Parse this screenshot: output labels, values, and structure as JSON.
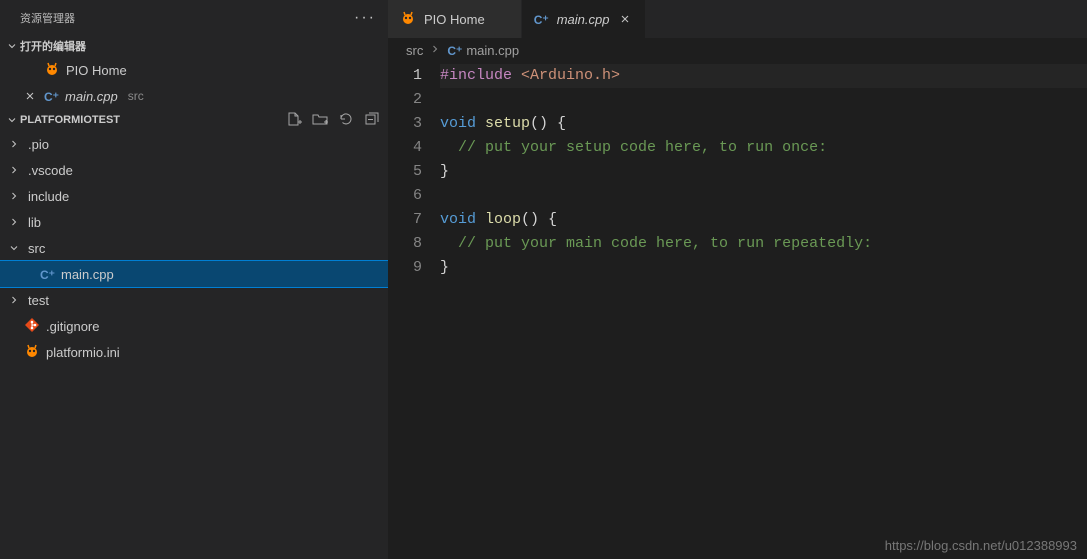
{
  "sidebar": {
    "title": "资源管理器",
    "openEditorsHeader": "打开的编辑器",
    "openEditors": [
      {
        "label": "PIO Home",
        "icon": "pio",
        "closable": false
      },
      {
        "label": "main.cpp",
        "dir": "src",
        "icon": "cpp",
        "closable": true,
        "italic": true
      }
    ],
    "projectName": "PLATFORMIOTEST",
    "tree": [
      {
        "label": ".pio",
        "type": "folder",
        "expanded": false,
        "depth": 0
      },
      {
        "label": ".vscode",
        "type": "folder",
        "expanded": false,
        "depth": 0
      },
      {
        "label": "include",
        "type": "folder",
        "expanded": false,
        "depth": 0
      },
      {
        "label": "lib",
        "type": "folder",
        "expanded": false,
        "depth": 0
      },
      {
        "label": "src",
        "type": "folder",
        "expanded": true,
        "depth": 0
      },
      {
        "label": "main.cpp",
        "type": "file",
        "icon": "cpp",
        "depth": 1,
        "selected": true
      },
      {
        "label": "test",
        "type": "folder",
        "expanded": false,
        "depth": 0
      },
      {
        "label": ".gitignore",
        "type": "file",
        "icon": "git",
        "depth": 0
      },
      {
        "label": "platformio.ini",
        "type": "file",
        "icon": "pio",
        "depth": 0
      }
    ]
  },
  "tabs": [
    {
      "label": "PIO Home",
      "icon": "pio",
      "active": false
    },
    {
      "label": "main.cpp",
      "icon": "cpp",
      "active": true,
      "italic": true
    }
  ],
  "breadcrumb": [
    {
      "label": "src"
    },
    {
      "label": "main.cpp",
      "icon": "cpp"
    }
  ],
  "code": {
    "activeLine": 1,
    "lines": [
      [
        {
          "t": "#include ",
          "c": "tok-include"
        },
        {
          "t": "<Arduino.h>",
          "c": "tok-string"
        }
      ],
      [],
      [
        {
          "t": "void",
          "c": "tok-keyword"
        },
        {
          "t": " "
        },
        {
          "t": "setup",
          "c": "tok-func"
        },
        {
          "t": "() {",
          "c": "tok-punc"
        }
      ],
      [
        {
          "t": "  "
        },
        {
          "t": "// put your setup code here, to run once:",
          "c": "tok-comment"
        }
      ],
      [
        {
          "t": "}",
          "c": "tok-punc"
        }
      ],
      [],
      [
        {
          "t": "void",
          "c": "tok-keyword"
        },
        {
          "t": " "
        },
        {
          "t": "loop",
          "c": "tok-func"
        },
        {
          "t": "() {",
          "c": "tok-punc"
        }
      ],
      [
        {
          "t": "  "
        },
        {
          "t": "// put your main code here, to run repeatedly:",
          "c": "tok-comment"
        }
      ],
      [
        {
          "t": "}",
          "c": "tok-punc"
        }
      ]
    ]
  },
  "watermark": "https://blog.csdn.net/u012388993"
}
